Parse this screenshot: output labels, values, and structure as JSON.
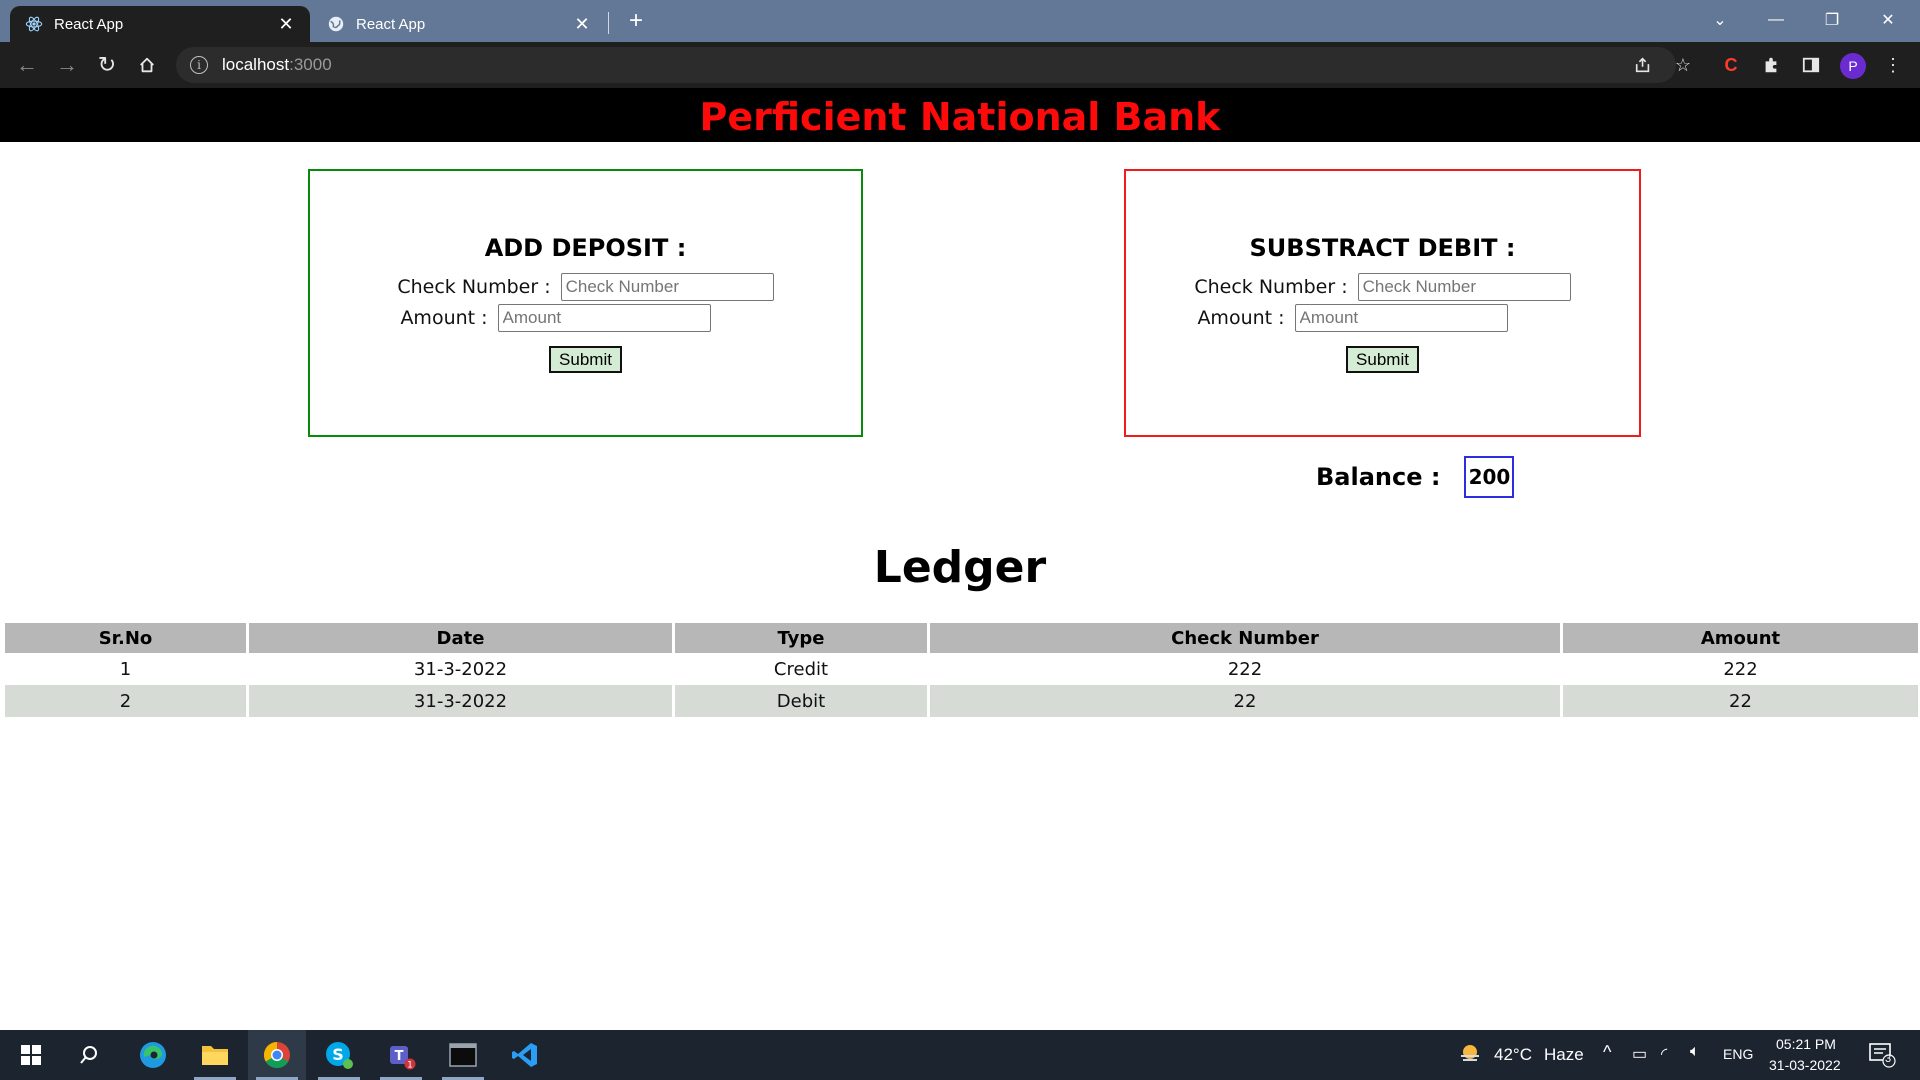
{
  "browser": {
    "tabs": [
      {
        "title": "React App",
        "active": true
      },
      {
        "title": "React App",
        "active": false
      }
    ],
    "address": {
      "host": "localhost",
      "port": ":3000"
    }
  },
  "app": {
    "title": "Perficient National Bank",
    "deposit": {
      "heading": "ADD DEPOSIT :",
      "check_label": "Check Number :",
      "check_placeholder": "Check Number",
      "amount_label": "Amount :",
      "amount_placeholder": "Amount",
      "submit": "Submit"
    },
    "debit": {
      "heading": "SUBSTRACT DEBIT :",
      "check_label": "Check Number :",
      "check_placeholder": "Check Number",
      "amount_label": "Amount :",
      "amount_placeholder": "Amount",
      "submit": "Submit"
    },
    "balance": {
      "label": "Balance :",
      "value": "200"
    },
    "ledger": {
      "title": "Ledger",
      "columns": [
        "Sr.No",
        "Date",
        "Type",
        "Check Number",
        "Amount"
      ],
      "rows": [
        {
          "sr": "1",
          "date": "31-3-2022",
          "type": "Credit",
          "check": "222",
          "amount": "222"
        },
        {
          "sr": "2",
          "date": "31-3-2022",
          "type": "Debit",
          "check": "22",
          "amount": "22"
        }
      ]
    }
  },
  "taskbar": {
    "weather": {
      "temp": "42°C",
      "condition": "Haze"
    },
    "language": "ENG",
    "time": "05:21 PM",
    "date": "31-03-2022",
    "notifications": "3"
  },
  "colors": {
    "title_red": "#ff0a0a",
    "deposit_border": "#0a8a0a",
    "debit_border": "#ee1c1c",
    "balance_border": "#2c2ce0",
    "header_bg": "#b7b7b7",
    "alt_row_bg": "#d6dbd6"
  }
}
